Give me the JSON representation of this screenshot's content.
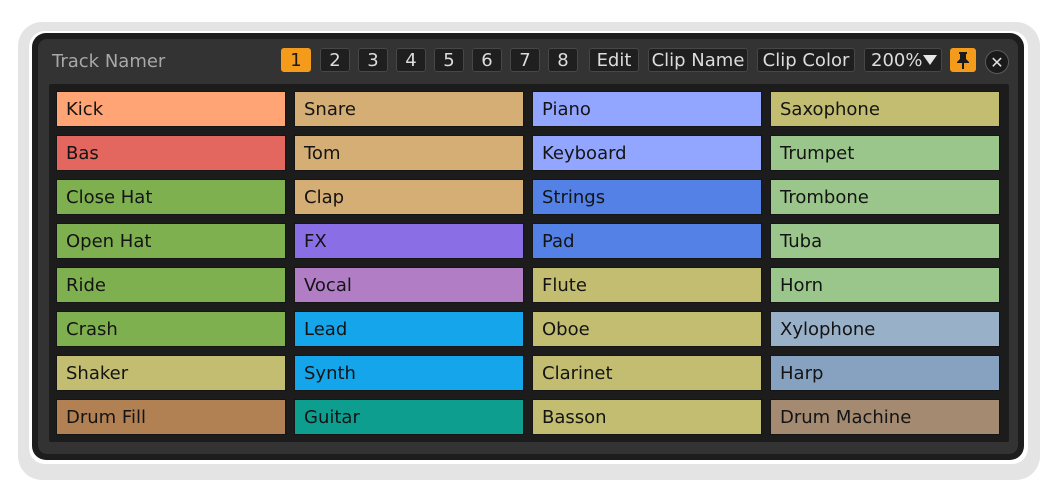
{
  "title": "Track Namer",
  "toolbar": {
    "pages": [
      "1",
      "2",
      "3",
      "4",
      "5",
      "6",
      "7",
      "8"
    ],
    "active_page": "1",
    "edit": "Edit",
    "clip_name": "Clip Name",
    "clip_color": "Clip Color",
    "zoom": "200%"
  },
  "colors": {
    "accent": "#f59b1b",
    "panel": "#333333",
    "window": "#1d1d1d"
  },
  "icons": {
    "zoom_dropdown": "triangle-down-icon",
    "pin": "pin-icon",
    "close": "close-icon"
  },
  "columns": [
    [
      {
        "name": "Kick",
        "color": "#ffa474"
      },
      {
        "name": "Bas",
        "color": "#e3665f"
      },
      {
        "name": "Close Hat",
        "color": "#7eb04f"
      },
      {
        "name": "Open Hat",
        "color": "#7eb04f"
      },
      {
        "name": "Ride",
        "color": "#7eb04f"
      },
      {
        "name": "Crash",
        "color": "#7eb04f"
      },
      {
        "name": "Shaker",
        "color": "#c3bd71"
      },
      {
        "name": "Drum Fill",
        "color": "#b18154"
      }
    ],
    [
      {
        "name": "Snare",
        "color": "#d4ae74"
      },
      {
        "name": "Tom",
        "color": "#d4ae74"
      },
      {
        "name": "Clap",
        "color": "#d4ae74"
      },
      {
        "name": "FX",
        "color": "#8a6ee6"
      },
      {
        "name": "Vocal",
        "color": "#b17ec6"
      },
      {
        "name": "Lead",
        "color": "#14a5ea"
      },
      {
        "name": "Synth",
        "color": "#14a5ea"
      },
      {
        "name": "Guitar",
        "color": "#0e9e8f"
      }
    ],
    [
      {
        "name": "Piano",
        "color": "#93a6ff"
      },
      {
        "name": "Keyboard",
        "color": "#93a6ff"
      },
      {
        "name": "Strings",
        "color": "#5481e5"
      },
      {
        "name": "Pad",
        "color": "#5481e5"
      },
      {
        "name": "Flute",
        "color": "#c3bd71"
      },
      {
        "name": "Oboe",
        "color": "#c3bd71"
      },
      {
        "name": "Clarinet",
        "color": "#c3bd71"
      },
      {
        "name": "Basson",
        "color": "#c3bd71"
      }
    ],
    [
      {
        "name": "Saxophone",
        "color": "#c3bd71"
      },
      {
        "name": "Trumpet",
        "color": "#9ac68b"
      },
      {
        "name": "Trombone",
        "color": "#9ac68b"
      },
      {
        "name": "Tuba",
        "color": "#9ac68b"
      },
      {
        "name": "Horn",
        "color": "#9ac68b"
      },
      {
        "name": "Xylophone",
        "color": "#98b0c8"
      },
      {
        "name": "Harp",
        "color": "#86a2c0"
      },
      {
        "name": "Drum Machine",
        "color": "#a38a71"
      }
    ]
  ]
}
